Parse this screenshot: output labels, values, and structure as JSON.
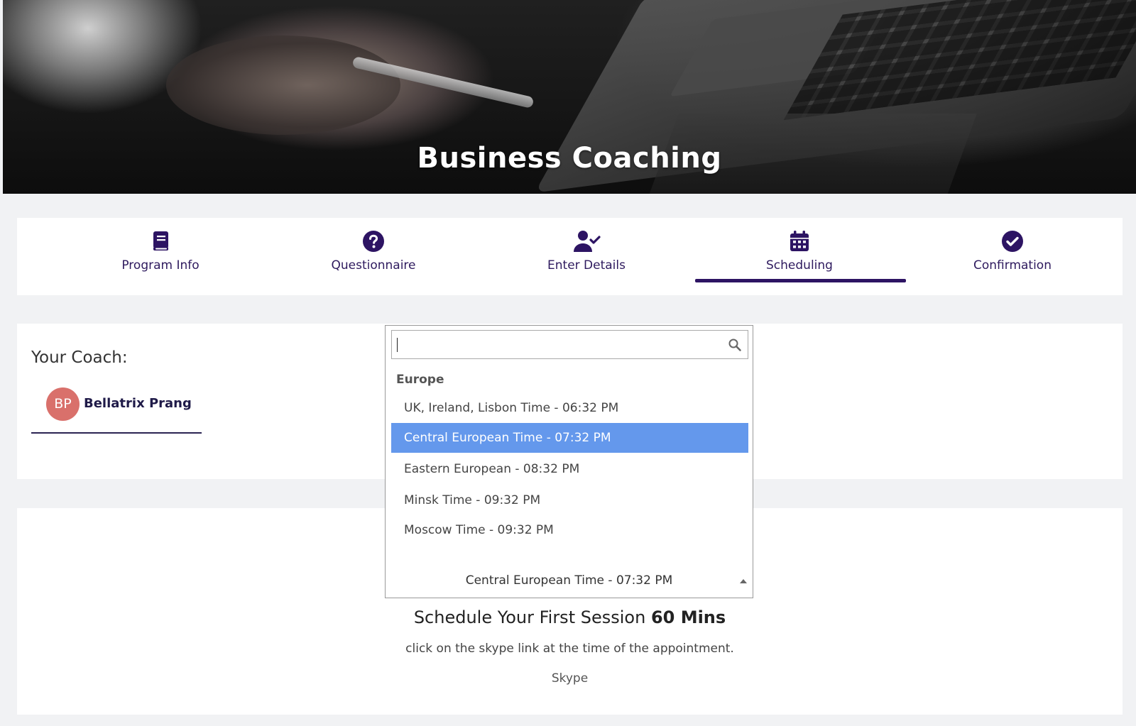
{
  "hero": {
    "title": "Business Coaching"
  },
  "steps": [
    {
      "label": "Program Info",
      "icon": "book-icon"
    },
    {
      "label": "Questionnaire",
      "icon": "question-circle-icon"
    },
    {
      "label": "Enter Details",
      "icon": "user-check-icon"
    },
    {
      "label": "Scheduling",
      "icon": "calendar-icon",
      "active": true
    },
    {
      "label": "Confirmation",
      "icon": "check-circle-icon"
    }
  ],
  "colors": {
    "accent": "#2d1463",
    "selected_option": "#6498ec",
    "avatar": "#d9706b"
  },
  "coach": {
    "heading": "Your Coach:",
    "initials": "BP",
    "name": "Bellatrix Prang"
  },
  "timezone_dropdown": {
    "search_value": "",
    "group": "Europe",
    "options": [
      "UK, Ireland, Lisbon Time - 06:32 PM",
      "Central European Time - 07:32 PM",
      "Eastern European - 08:32 PM",
      "Minsk Time - 09:32 PM",
      "Moscow Time - 09:32 PM"
    ],
    "selected": "Central European Time - 07:32 PM"
  },
  "schedule": {
    "title_prefix": "Schedule Your First Session",
    "duration": "60 Mins",
    "note": "click on the skype link at the time of the appointment.",
    "method": "Skype"
  }
}
